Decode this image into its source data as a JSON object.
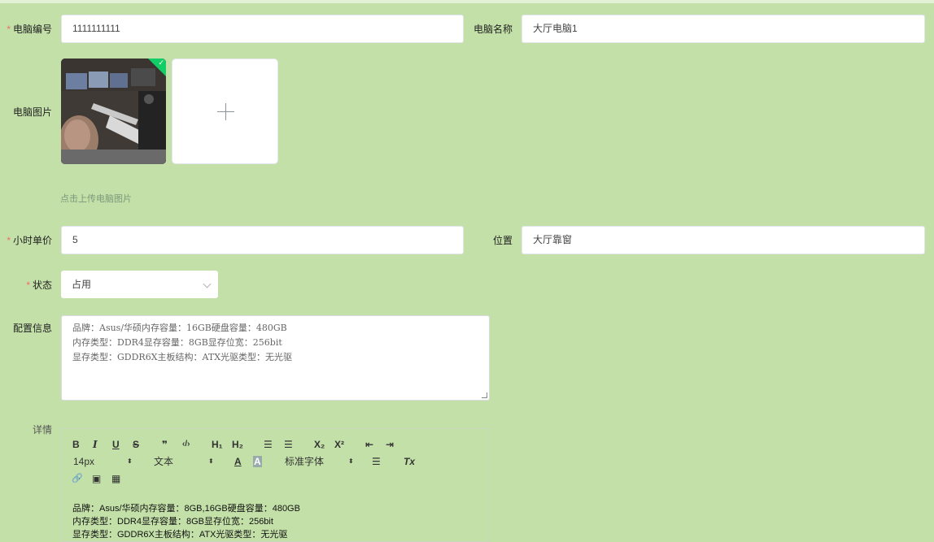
{
  "form": {
    "computer_id": {
      "label": "电脑编号",
      "required_mark": "*",
      "value": "1111111111"
    },
    "computer_name": {
      "label": "电脑名称",
      "value": "大厅电脑1"
    },
    "computer_image": {
      "label": "电脑图片",
      "hint": "点击上传电脑图片",
      "upload_icon": "plus-icon",
      "uploaded_badge_icon": "check-icon"
    },
    "hourly_price": {
      "label": "小时单价",
      "required_mark": "*",
      "value": "5"
    },
    "location": {
      "label": "位置",
      "value": "大厅靠窗"
    },
    "status": {
      "label": "状态",
      "required_mark": "*",
      "value": "占用",
      "icon": "chevron-down-icon"
    },
    "config": {
      "label": "配置信息",
      "lines": [
        "品牌：Asus/华硕内存容量：16GB硬盘容量：480GB",
        "内存类型：DDR4显存容量：8GB显存位宽：256bit",
        "显存类型：GDDR6X主板结构：ATX光驱类型：无光驱"
      ]
    },
    "details": {
      "label": "详情",
      "toolbar": {
        "bold": "B",
        "italic": "I",
        "underline": "U",
        "strike": "S",
        "blockquote": "❞",
        "code": "‹/›",
        "h1": "H₁",
        "h2": "H₂",
        "ordered_list": "☰",
        "bullet_list": "☰",
        "subscript": "X₂",
        "superscript": "X²",
        "outdent": "⇤",
        "indent": "⇥",
        "size": "14px",
        "header": "文本",
        "font": "标准字体",
        "font_color": "A",
        "background_color": "A",
        "align": "☰",
        "clean": "Tx",
        "link": "🔗",
        "image": "▣",
        "video": "▦"
      },
      "content": [
        "品牌：Asus/华硕内存容量：8GB,16GB硬盘容量：480GB",
        "内存类型：DDR4显存容量：8GB显存位宽：256bit",
        "显存类型：GDDR6X主板结构：ATX光驱类型：无光驱"
      ]
    }
  },
  "colors": {
    "background": "#c3e0a8",
    "required": "#f56c6c",
    "success_badge": "#13ce66"
  }
}
